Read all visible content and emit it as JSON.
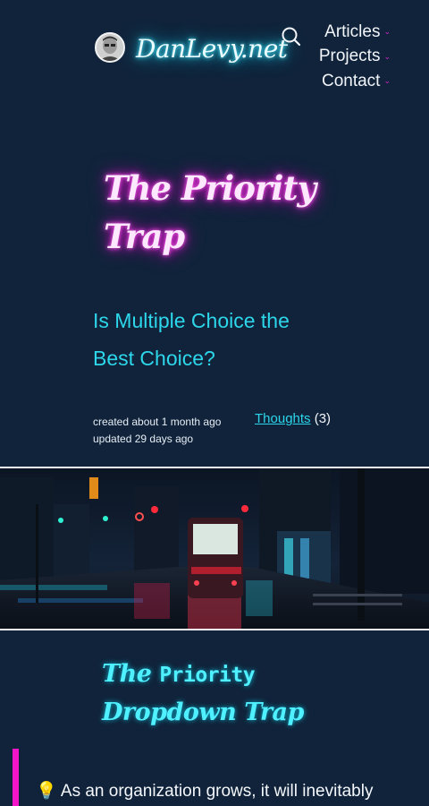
{
  "header": {
    "site_name": "DanLevy.net",
    "nav": [
      {
        "label": "Articles"
      },
      {
        "label": "Projects"
      },
      {
        "label": "Contact"
      }
    ]
  },
  "article": {
    "title": "The Priority Trap",
    "subtitle": "Is Multiple Choice the Best Choice?",
    "created": "created about 1 month ago",
    "updated": "updated 29 days ago",
    "category": "Thoughts",
    "category_count": "(3)"
  },
  "content": {
    "heading_word1": "The",
    "heading_word2": "Priority",
    "heading_line2": "Dropdown Trap",
    "callout_icon": "💡",
    "callout_text": "As an organization grows, it will inevitably"
  },
  "icons": {
    "search": "search-icon",
    "chevron": "chevron-down-icon",
    "avatar": "avatar"
  },
  "colors": {
    "background": "#10233a",
    "accent_cyan": "#2dd6ea",
    "accent_magenta": "#e023c8"
  }
}
